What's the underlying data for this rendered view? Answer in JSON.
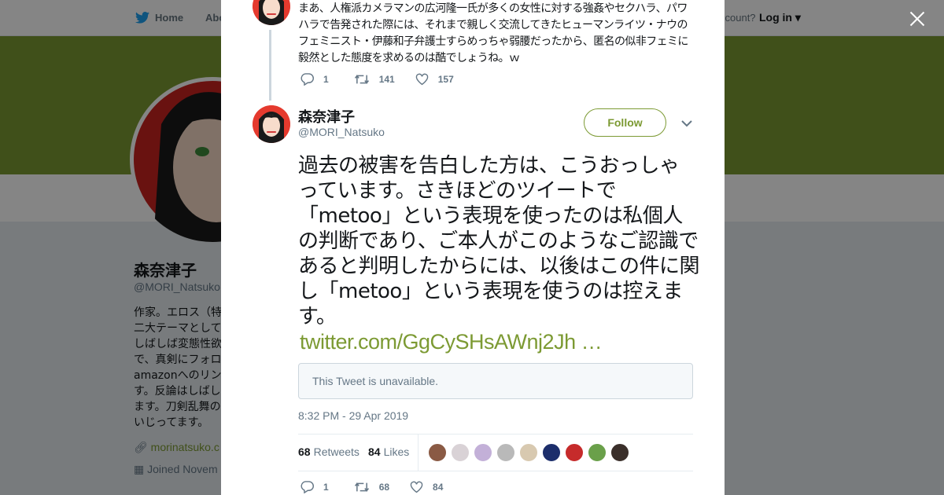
{
  "nav": {
    "home_label": "Home",
    "about_label": "Abo",
    "account_prompt": "ccount?",
    "login_label": "Log in"
  },
  "profile": {
    "name": "森奈津子",
    "handle": "@MORI_Natsuko",
    "bio_lines": [
      "作家。エロス（特",
      "二大テーマとして",
      "しばしば変態性欲",
      "で、真剣にフォロ",
      "amazonへのリンク",
      "す。反論はしばし",
      "ます。刀剣乱舞の",
      "いじってます。"
    ],
    "website": "morinatsuko.c",
    "joined": "Joined Novem"
  },
  "previous_tweet": {
    "text": "まあ、人権派カメラマンの広河隆一氏が多くの女性に対する強姦やセクハラ、パワハラで告発された際には、それまで親しく交流してきたヒューマンライツ・ナウのフェミニスト・伊藤和子弁護士すらめっちゃ弱腰だったから、匿名の似非フェミに毅然とした態度を求めるのは酷でしょうね。ｗ",
    "replies": "1",
    "retweets": "141",
    "likes": "157"
  },
  "tweet": {
    "author_name": "森奈津子",
    "author_handle": "@MORI_Natsuko",
    "follow_label": "Follow",
    "text": "過去の被害を告白した方は、こうおっしゃっています。さきほどのツイートで「metoo」という表現を使ったのは私個人の判断であり、ご本人がこのようなご認識であると判明したからには、以後はこの件に関し「metoo」という表現を使うのは控えます。",
    "link": "twitter.com/GgCySHsAWnj2Jh …",
    "quoted_unavailable": "This Tweet is unavailable.",
    "timestamp": "8:32 PM - 29 Apr 2019",
    "retweet_count": "68",
    "retweet_label": "Retweets",
    "like_count": "84",
    "like_label": "Likes",
    "replies": "1",
    "retweets": "68",
    "likes": "84"
  },
  "colors": {
    "accent": "#7c9a33",
    "text": "#14171a",
    "muted": "#657786",
    "border": "#e6ecf0"
  },
  "liker_avatar_colors": [
    "#8a5a44",
    "#d9d2d6",
    "#c3b0d8",
    "#b9b9b9",
    "#d8c9b0",
    "#1c2e6b",
    "#c62b2b",
    "#6aa04a",
    "#3a2f2a"
  ]
}
